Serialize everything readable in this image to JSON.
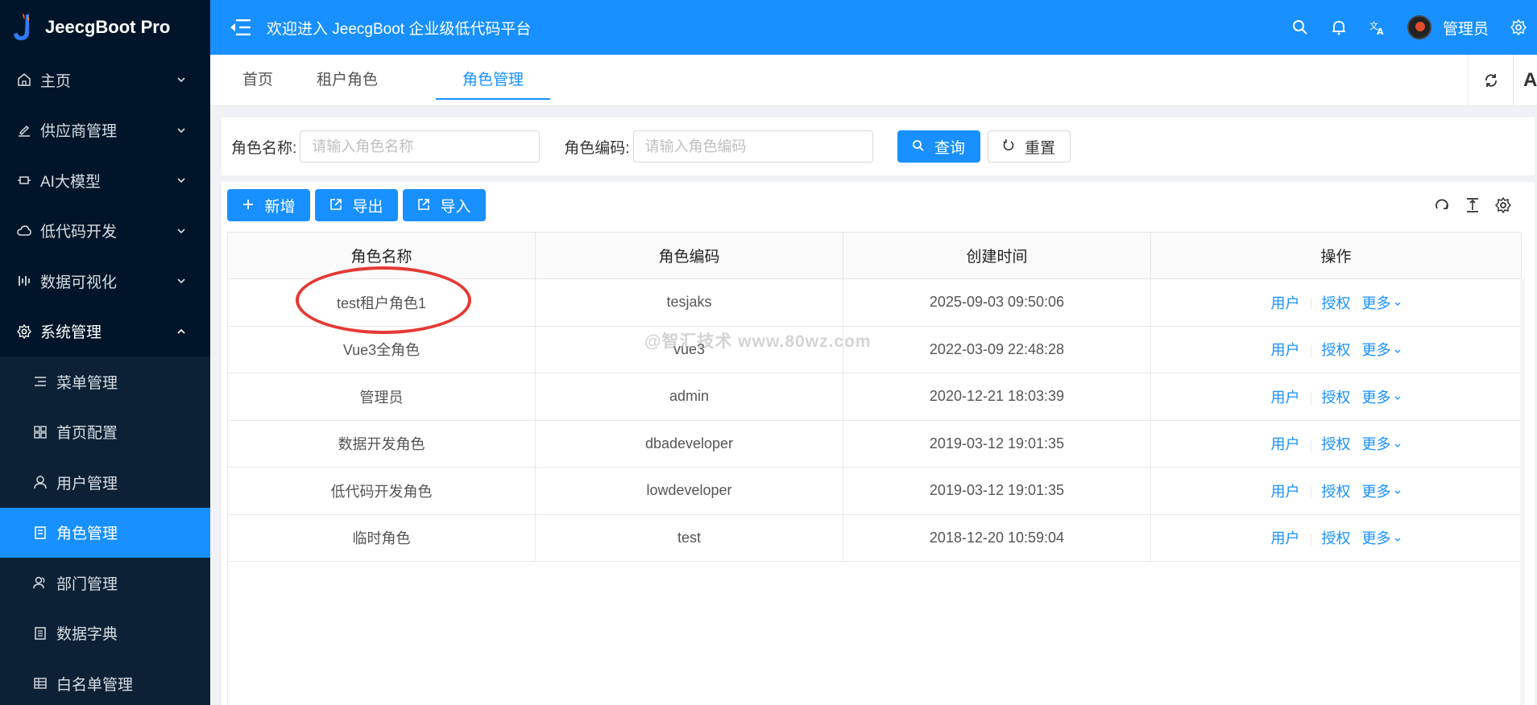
{
  "app": {
    "title": "JeecgBoot Pro"
  },
  "colors": {
    "primary": "#1890ff",
    "sidebar_bg": "#001529",
    "annotation": "#e53935"
  },
  "sidebar": {
    "items": [
      {
        "label": "主页",
        "icon": "home-icon",
        "expanded": false
      },
      {
        "label": "供应商管理",
        "icon": "edit-icon",
        "expanded": false
      },
      {
        "label": "AI大模型",
        "icon": "ai-icon",
        "expanded": false
      },
      {
        "label": "低代码开发",
        "icon": "cloud-icon",
        "expanded": false
      },
      {
        "label": "数据可视化",
        "icon": "chart-icon",
        "expanded": false
      },
      {
        "label": "系统管理",
        "icon": "gear-icon",
        "expanded": true
      }
    ],
    "subitems": [
      {
        "label": "菜单管理",
        "icon": "menu-list-icon"
      },
      {
        "label": "首页配置",
        "icon": "grid-icon"
      },
      {
        "label": "用户管理",
        "icon": "user-icon"
      },
      {
        "label": "角色管理",
        "icon": "role-icon",
        "active": true
      },
      {
        "label": "部门管理",
        "icon": "department-icon"
      },
      {
        "label": "数据字典",
        "icon": "dictionary-icon"
      },
      {
        "label": "白名单管理",
        "icon": "table-icon"
      }
    ]
  },
  "header": {
    "welcome": "欢迎进入 JeecgBoot 企业级低代码平台",
    "username": "管理员"
  },
  "tabs": [
    {
      "label": "首页"
    },
    {
      "label": "租户角色"
    },
    {
      "label": "角色管理",
      "active": true
    }
  ],
  "tab_tools": {
    "ai_label": "Ai"
  },
  "search": {
    "name_label": "角色名称:",
    "name_placeholder": "请输入角色名称",
    "code_label": "角色编码:",
    "code_placeholder": "请输入角色编码",
    "query_button": "查询",
    "reset_button": "重置"
  },
  "toolbar": {
    "add_button": "新增",
    "export_button": "导出",
    "import_button": "导入"
  },
  "table": {
    "columns": [
      "角色名称",
      "角色编码",
      "创建时间",
      "操作"
    ],
    "rows": [
      {
        "name": "test租户角色1",
        "code": "tesjaks",
        "created": "2025-09-03 09:50:06"
      },
      {
        "name": "Vue3全角色",
        "code": "vue3",
        "created": "2022-03-09 22:48:28"
      },
      {
        "name": "管理员",
        "code": "admin",
        "created": "2020-12-21 18:03:39"
      },
      {
        "name": "数据开发角色",
        "code": "dbadeveloper",
        "created": "2019-03-12 19:01:35"
      },
      {
        "name": "低代码开发角色",
        "code": "lowdeveloper",
        "created": "2019-03-12 19:01:35"
      },
      {
        "name": "临时角色",
        "code": "test",
        "created": "2018-12-20 10:59:04"
      }
    ],
    "actions": {
      "users": "用户",
      "auth": "授权",
      "more": "更多"
    }
  },
  "watermark": "@智汇技术 www.80wz.com"
}
